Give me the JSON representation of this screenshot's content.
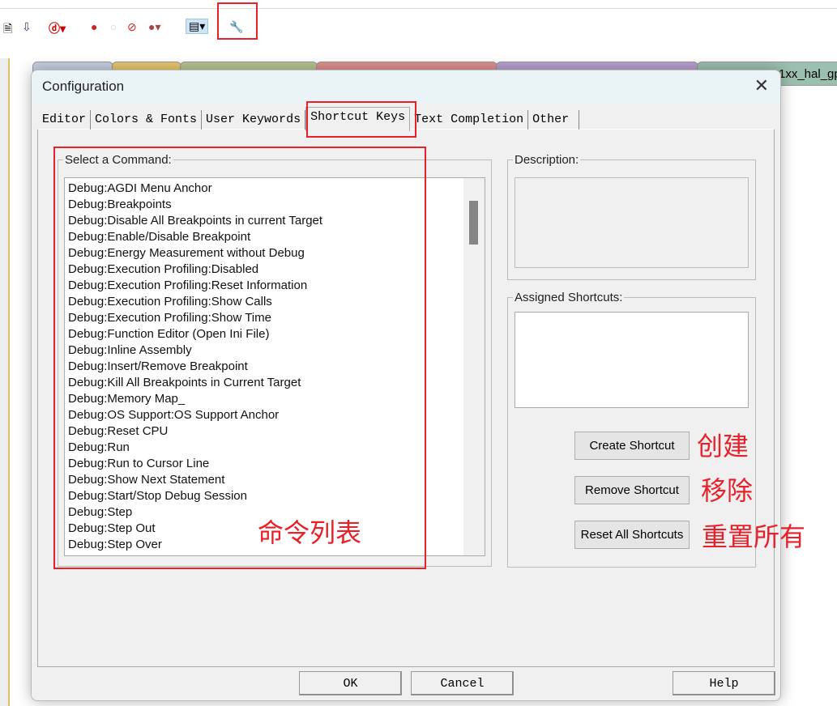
{
  "toolbar": {
    "icons": [
      "document-icon",
      "download-icon",
      "debug-zoom-icon",
      "breakpoint-icon",
      "disabled-breakpoint-icon",
      "kill-breakpoints-icon",
      "watch-icon",
      "window-icon",
      "wrench-icon"
    ]
  },
  "doc_tabs": {
    "partial_label": "1xx_hal_gp",
    "colors": [
      "#c7cfe0",
      "#e8c870",
      "#b8c490",
      "#e09090",
      "#b8a0d0",
      "#9cc0b0"
    ]
  },
  "dialog": {
    "title": "Configuration",
    "tabs": [
      "Editor",
      "Colors & Fonts",
      "User Keywords",
      "Shortcut Keys",
      "Text Completion",
      "Other"
    ],
    "active_tab": "Shortcut Keys",
    "select_command_label": "Select a Command:",
    "commands": [
      "Debug:AGDI Menu Anchor",
      "Debug:Breakpoints",
      "Debug:Disable All Breakpoints in current Target",
      "Debug:Enable/Disable Breakpoint",
      "Debug:Energy Measurement without Debug",
      "Debug:Execution Profiling:Disabled",
      "Debug:Execution Profiling:Reset Information",
      "Debug:Execution Profiling:Show Calls",
      "Debug:Execution Profiling:Show Time",
      "Debug:Function Editor (Open Ini File)",
      "Debug:Inline Assembly",
      "Debug:Insert/Remove Breakpoint",
      "Debug:Kill All Breakpoints in Current Target",
      "Debug:Memory Map_",
      "Debug:OS Support:OS Support Anchor",
      "Debug:Reset CPU",
      "Debug:Run",
      "Debug:Run to Cursor Line",
      "Debug:Show Next Statement",
      "Debug:Start/Stop Debug Session",
      "Debug:Step",
      "Debug:Step Out",
      "Debug:Step Over"
    ],
    "description_label": "Description:",
    "assigned_label": "Assigned Shortcuts:",
    "create_label": "Create Shortcut",
    "remove_label": "Remove Shortcut",
    "reset_label": "Reset All Shortcuts",
    "ok_label": "OK",
    "cancel_label": "Cancel",
    "help_label": "Help"
  },
  "annotations": {
    "create": "创建",
    "remove": "移除",
    "reset": "重置所有",
    "list": "命令列表",
    "color": "#e8202a"
  }
}
